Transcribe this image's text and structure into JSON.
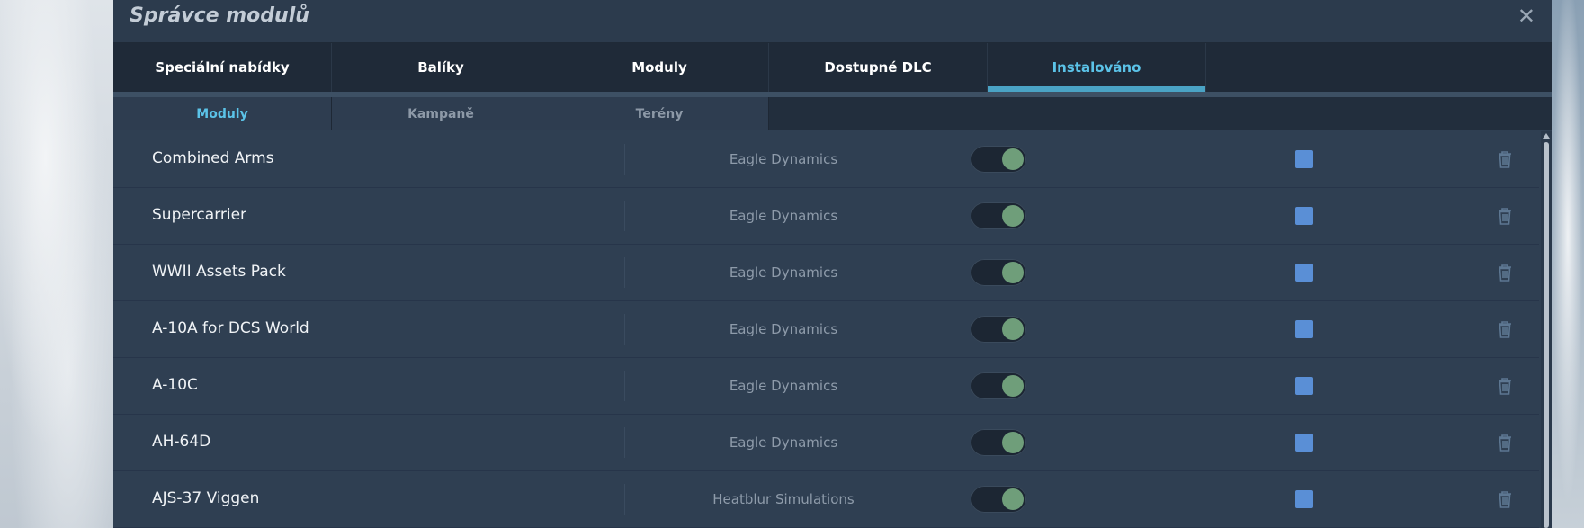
{
  "dialog": {
    "title": "Správce modulů",
    "close_icon": "✕"
  },
  "tabs": [
    {
      "label": "Speciální nabídky",
      "active": false
    },
    {
      "label": "Balíky",
      "active": false
    },
    {
      "label": "Moduly",
      "active": false
    },
    {
      "label": "Dostupné DLC",
      "active": false
    },
    {
      "label": "Instalováno",
      "active": true
    }
  ],
  "subtabs": [
    {
      "label": "Moduly",
      "active": true
    },
    {
      "label": "Kampaně",
      "active": false
    },
    {
      "label": "Terény",
      "active": false
    }
  ],
  "modules": [
    {
      "name": "Combined Arms",
      "developer": "Eagle Dynamics",
      "enabled": true,
      "checked": true
    },
    {
      "name": "Supercarrier",
      "developer": "Eagle Dynamics",
      "enabled": true,
      "checked": true
    },
    {
      "name": "WWII Assets Pack",
      "developer": "Eagle Dynamics",
      "enabled": true,
      "checked": true
    },
    {
      "name": "A-10A for DCS World",
      "developer": "Eagle Dynamics",
      "enabled": true,
      "checked": true
    },
    {
      "name": "A-10C",
      "developer": "Eagle Dynamics",
      "enabled": true,
      "checked": true
    },
    {
      "name": "AH-64D",
      "developer": "Eagle Dynamics",
      "enabled": true,
      "checked": true
    },
    {
      "name": "AJS-37 Viggen",
      "developer": "Heatblur Simulations",
      "enabled": true,
      "checked": true
    }
  ],
  "colors": {
    "accent": "#5bc3e8",
    "toggle_on": "#6f9e7a",
    "checkbox": "#5a8fd6",
    "panel": "#2f3f52"
  },
  "icons": {
    "close": "close-icon",
    "trash": "trash-icon",
    "scroll_up": "scroll-up-icon"
  }
}
